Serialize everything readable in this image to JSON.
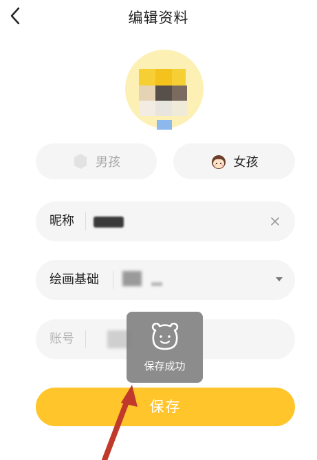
{
  "header": {
    "title": "编辑资料",
    "back_icon": "chevron-left-icon"
  },
  "gender": {
    "boy_label": "男孩",
    "girl_label": "女孩",
    "selected": "女孩"
  },
  "fields": {
    "nickname_label": "昵称",
    "drawing_level_label": "绘画基础",
    "account_label": "账号"
  },
  "toast": {
    "text": "保存成功",
    "icon": "bear-face-icon"
  },
  "save_button": {
    "label": "保存"
  },
  "colors": {
    "accent": "#ffc52a",
    "field_bg": "#f5f5f5",
    "toast_bg": "#828282",
    "annotation_arrow": "#c0392b"
  }
}
